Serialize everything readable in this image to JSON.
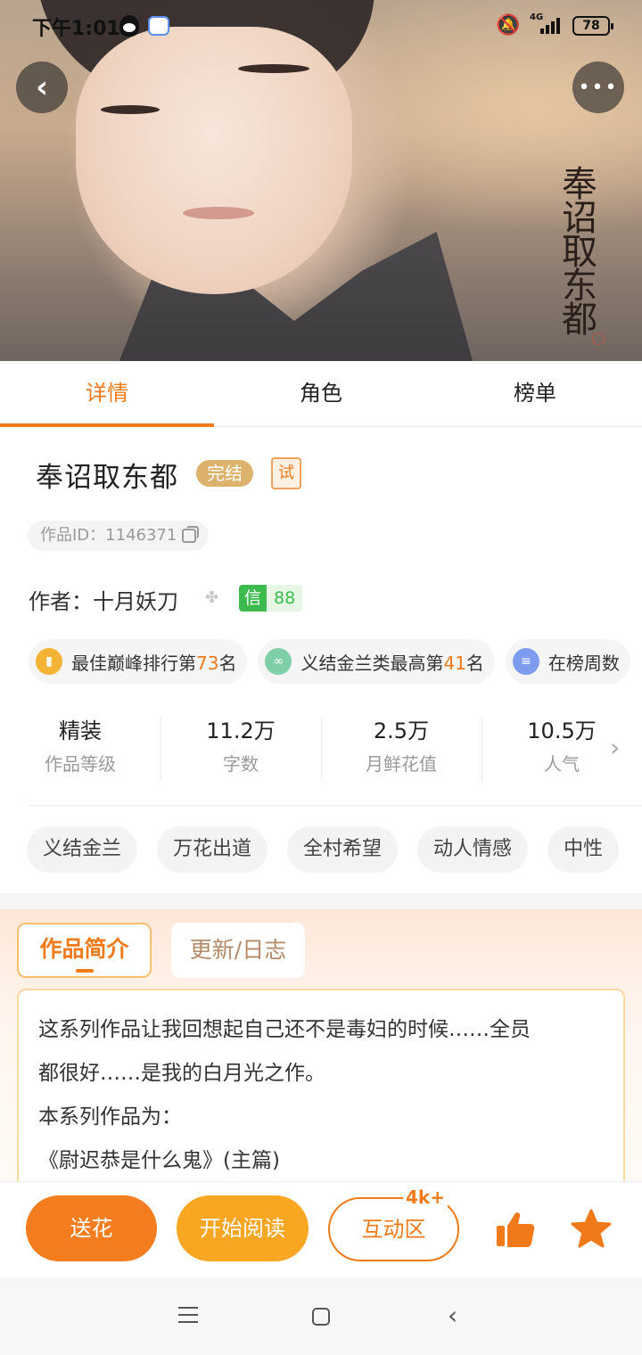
{
  "status_bar": {
    "time": "下午1:01",
    "network": "4G",
    "battery": "78",
    "icons": [
      "qq-icon",
      "cloud-app-icon",
      "mute-bell-icon",
      "signal-icon",
      "battery-icon"
    ]
  },
  "cover": {
    "calligraphy": "奉诏取东都",
    "icons": {
      "back": "back-arrow-icon",
      "more": "more-dots-icon"
    }
  },
  "tabs": [
    {
      "label": "详情",
      "active": true
    },
    {
      "label": "角色",
      "active": false
    },
    {
      "label": "榜单",
      "active": false
    }
  ],
  "work": {
    "title": "奉诏取东都",
    "status_badge": "完结",
    "trial_badge": "试",
    "id_text": "作品ID：1146371",
    "author_text": "作者：十月妖刀",
    "trust_label": "信",
    "trust_score": "88"
  },
  "rankings": [
    {
      "prefix": "最佳巅峰排行第",
      "rank": "73",
      "suffix": "名",
      "icon": "chart-bar-icon",
      "color": "#f5b335"
    },
    {
      "prefix": "义结金兰类最高第",
      "rank": "41",
      "suffix": "名",
      "icon": "rings-icon",
      "color": "#7fd0a8"
    },
    {
      "prefix": "在榜周数",
      "rank": "",
      "suffix": "",
      "icon": "list-doc-icon",
      "color": "#7d9cf0"
    }
  ],
  "stats": [
    {
      "value": "精装",
      "label": "作品等级"
    },
    {
      "value": "11.2万",
      "label": "字数"
    },
    {
      "value": "2.5万",
      "label": "月鲜花值"
    },
    {
      "value": "10.5万",
      "label": "人气"
    }
  ],
  "tags": [
    "义结金兰",
    "万花出道",
    "全村希望",
    "动人情感",
    "中性"
  ],
  "intro_tabs": {
    "intro": "作品简介",
    "updates": "更新/日志"
  },
  "intro_lines": [
    "这系列作品让我回想起自己还不是毒妇的时候……全员",
    "都很好……是我的白月光之作。",
    "本系列作品为：",
    "《尉迟恭是什么鬼》(主篇)"
  ],
  "actions": {
    "flower": "送花",
    "read": "开始阅读",
    "interact": "互动区",
    "interact_badge": "4k+",
    "like_icon": "thumbs-up-icon",
    "fav_icon": "star-icon"
  },
  "colors": {
    "accent": "#f07a1a",
    "read": "#f9a623",
    "status_badge": "#ddb26c",
    "trust": "#3dbb4f"
  }
}
